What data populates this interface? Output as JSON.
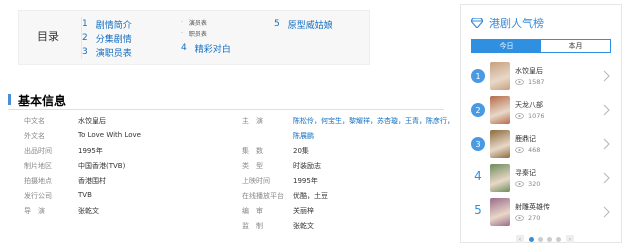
{
  "toc": {
    "title": "目录",
    "col1": [
      {
        "num": "1",
        "label": "剧情简介"
      },
      {
        "num": "2",
        "label": "分集剧情"
      },
      {
        "num": "3",
        "label": "演职员表"
      }
    ],
    "col2_subs": [
      "演员表",
      "职员表"
    ],
    "col2_item": {
      "num": "4",
      "label": "精彩对白"
    },
    "col3": {
      "num": "5",
      "label": "原型威姑娘"
    }
  },
  "section": {
    "title": "基本信息"
  },
  "info": {
    "left": [
      {
        "label": "中文名",
        "value": "水饺皇后"
      },
      {
        "label": "外文名",
        "value": "To Love With Love"
      },
      {
        "label": "出品时间",
        "value": "1995年"
      },
      {
        "label": "制片地区",
        "value": "中国香港(TVB)"
      },
      {
        "label": "拍摄地点",
        "value": "香港围村"
      },
      {
        "label": "发行公司",
        "value": "TVB"
      },
      {
        "label": "导　演",
        "value": "张乾文"
      }
    ],
    "right": [
      {
        "label": "主　演",
        "value": "陈松伶，何宝生，黎耀祥，苏杏璇，王青，陈彦行，",
        "link": true
      },
      {
        "label": "",
        "value": "陈展鹏",
        "link": true
      },
      {
        "label": "集　数",
        "value": "20集"
      },
      {
        "label": "类　型",
        "value": "时装励志"
      },
      {
        "label": "上映时间",
        "value": "1995年"
      },
      {
        "label": "在线播放平台",
        "value": "优酷，土豆"
      },
      {
        "label": "编　审",
        "value": "关丽梓"
      },
      {
        "label": "监　制",
        "value": "张乾文"
      }
    ]
  },
  "panel": {
    "title": "港剧人气榜",
    "tabs": [
      {
        "label": "今日",
        "active": true
      },
      {
        "label": "本月",
        "active": false
      }
    ],
    "items": [
      {
        "rank": "1",
        "name": "水饺皇后",
        "views": "1587",
        "color": "#c7a07e"
      },
      {
        "rank": "2",
        "name": "天龙八部",
        "views": "1076",
        "color": "#b56b4a"
      },
      {
        "rank": "3",
        "name": "鹿鼎记",
        "views": "468",
        "color": "#8c6a3c"
      },
      {
        "rank": "4",
        "name": "寻秦记",
        "views": "320",
        "color": "#6d8b5a"
      },
      {
        "rank": "5",
        "name": "射雕英雄传",
        "views": "270",
        "color": "#9a6b8a"
      }
    ]
  },
  "colors": {
    "accent": "#2f8fe0",
    "link": "#136ec2"
  }
}
